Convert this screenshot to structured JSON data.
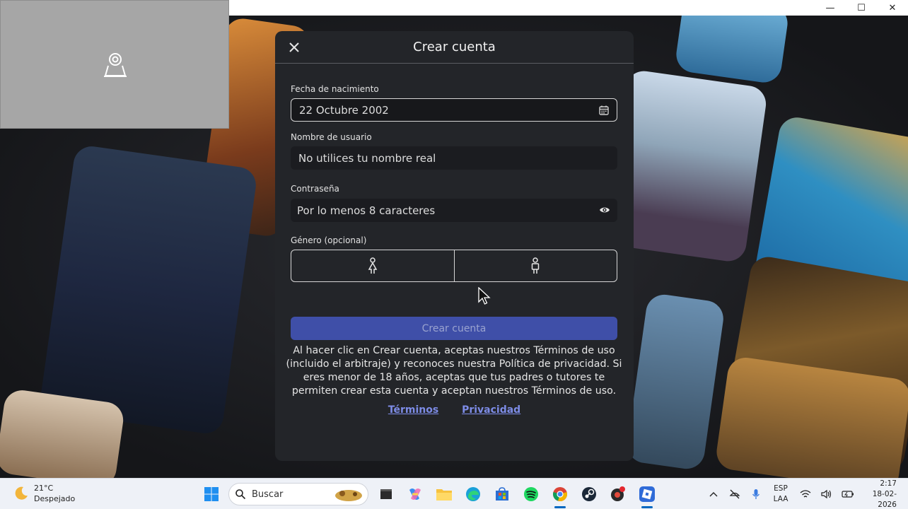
{
  "window": {
    "minimize": "—",
    "maximize": "☐",
    "close": "✕"
  },
  "modal": {
    "title": "Crear cuenta",
    "birthdate": {
      "label": "Fecha de nacimiento",
      "value": "22 Octubre 2002"
    },
    "username": {
      "label": "Nombre de usuario",
      "placeholder": "No utilices tu nombre real"
    },
    "password": {
      "label": "Contraseña",
      "placeholder": "Por lo menos 8 caracteres"
    },
    "gender": {
      "label": "Género (opcional)"
    },
    "create_button": "Crear cuenta",
    "legal_text": "Al hacer clic en Crear cuenta, aceptas nuestros Términos de uso (incluido el arbitraje) y reconoces nuestra Política de privacidad. Si eres menor de 18 años, aceptas que tus padres o tutores te permiten crear esta cuenta y aceptan nuestros Términos de uso.",
    "links": {
      "terms": "Términos",
      "privacy": "Privacidad"
    }
  },
  "taskbar": {
    "weather": {
      "temp": "21°C",
      "condition": "Despejado"
    },
    "search_placeholder": "Buscar",
    "pinned": [
      "windows-start-icon",
      "terminal-icon",
      "copilot-icon",
      "file-explorer-icon",
      "edge-icon",
      "store-icon",
      "spotify-icon",
      "chrome-icon",
      "steam-icon",
      "game-icon",
      "roblox-icon"
    ],
    "tray": {
      "lang_top": "ESP",
      "lang_bottom": "LAA",
      "time": "2:17",
      "date": "18-02-2026"
    }
  },
  "colors": {
    "modal_bg": "#232529",
    "accent": "#3f4fa8",
    "link": "#7d8ce6"
  }
}
